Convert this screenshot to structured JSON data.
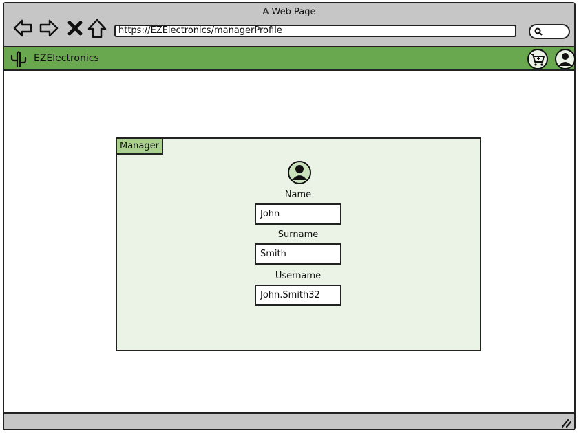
{
  "window": {
    "title": "A Web Page",
    "url": "https://EZElectronics/managerProfile"
  },
  "navbar": {
    "back_icon": "arrow-left-icon",
    "forward_icon": "arrow-right-icon",
    "stop_icon": "close-icon",
    "home_icon": "home-icon",
    "search_icon": "search-icon"
  },
  "appbar": {
    "logo_icon": "cactus-icon",
    "brand": "EZElectronics",
    "cart_icon": "cart-icon",
    "profile_icon": "user-icon",
    "color": "#6aa84f"
  },
  "panel": {
    "tab_label": "Manager",
    "avatar_icon": "user-avatar-icon",
    "background": "#ebf3e6",
    "fields": [
      {
        "label": "Name",
        "value": "John"
      },
      {
        "label": "Surname",
        "value": "Smith"
      },
      {
        "label": "Username",
        "value": "John.Smith32"
      }
    ]
  },
  "statusbar": {
    "resize_icon": "resize-grip-icon"
  }
}
